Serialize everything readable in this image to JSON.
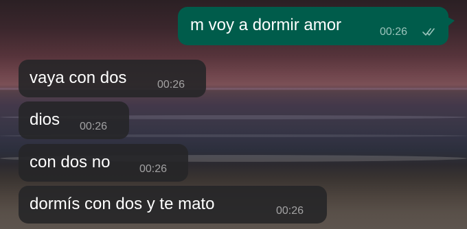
{
  "messages": [
    {
      "direction": "outgoing",
      "text": "m voy a dormir amor",
      "time": "00:26",
      "status_icon": "double-check-icon"
    },
    {
      "direction": "incoming",
      "text": "vaya con dos",
      "time": "00:26"
    },
    {
      "direction": "incoming",
      "text": "dios",
      "time": "00:26"
    },
    {
      "direction": "incoming",
      "text": "con dos no",
      "time": "00:26"
    },
    {
      "direction": "incoming",
      "text": "dormís con dos y te mato",
      "time": "00:26"
    }
  ],
  "colors": {
    "outgoing_bubble": "#005c4b",
    "incoming_bubble": "#262628",
    "text": "#ffffff",
    "timestamp": "#a8a8a8"
  }
}
